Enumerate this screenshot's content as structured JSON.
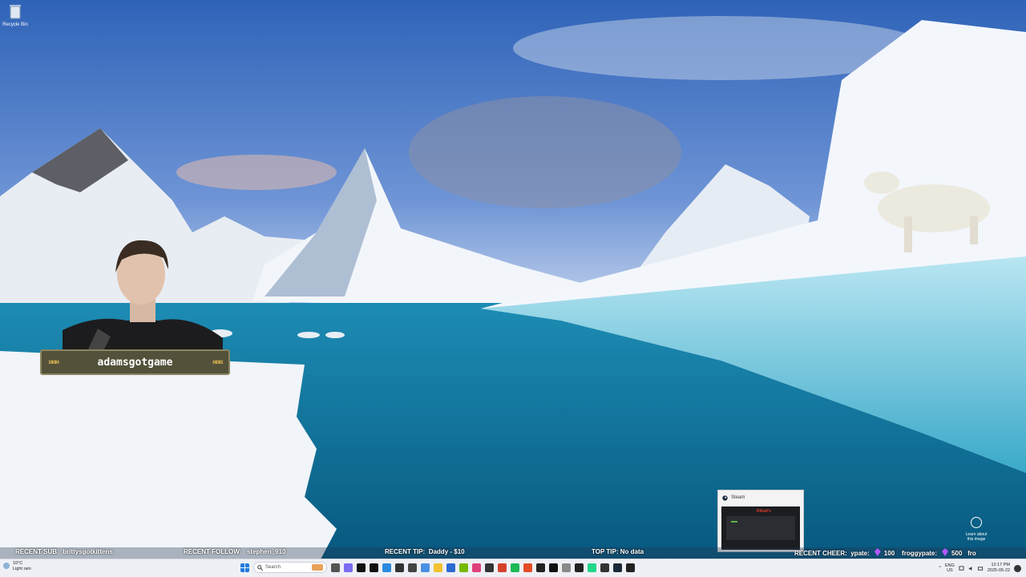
{
  "desktop": {
    "icons": [
      {
        "label": "Recycle Bin",
        "icon": "recycle-bin-icon"
      }
    ]
  },
  "overlay": {
    "streamer_name": "adamsgotgame",
    "ticker": {
      "recent_sub_label": "RECENT SUB:",
      "recent_sub_value": "brittysgotkittens",
      "recent_follow_label": "RECENT FOLLOW:",
      "recent_follow_value": "stephen_910",
      "recent_tip_label": "RECENT TIP:",
      "recent_tip_value": "Daddy - $10",
      "top_tip_label": "TOP TIP:",
      "top_tip_value": "No data",
      "recent_cheer_label": "RECENT CHEER:",
      "cheers": [
        {
          "user": "ypate:",
          "amount": "100"
        },
        {
          "user": "froggypate:",
          "amount": "500"
        }
      ],
      "trailing": "fro"
    }
  },
  "notification": {
    "app": "Steam",
    "preview_text": "Ritual's"
  },
  "learn_about": {
    "line1": "Learn about",
    "line2": "this image"
  },
  "taskbar": {
    "weather_temp": "10°C",
    "weather_desc": "Light rain",
    "search_placeholder": "Search",
    "pinned": [
      {
        "name": "task-view-icon",
        "color": "#555"
      },
      {
        "name": "copilot-icon",
        "color": "#7b6cf0"
      },
      {
        "name": "tiktok-icon",
        "color": "#111"
      },
      {
        "name": "tiktok-2-icon",
        "color": "#111"
      },
      {
        "name": "edge-icon",
        "color": "#2a8be0"
      },
      {
        "name": "obs-icon",
        "color": "#333"
      },
      {
        "name": "app-icon",
        "color": "#444"
      },
      {
        "name": "photos-icon",
        "color": "#4a90e2"
      },
      {
        "name": "file-explorer-icon",
        "color": "#f2c230"
      },
      {
        "name": "store-icon",
        "color": "#2a6bd1"
      },
      {
        "name": "nvidia-icon",
        "color": "#76b900"
      },
      {
        "name": "app2-icon",
        "color": "#e0407a"
      },
      {
        "name": "app3-icon",
        "color": "#333"
      },
      {
        "name": "app4-icon",
        "color": "#d4422d"
      },
      {
        "name": "spotify-icon",
        "color": "#1db954"
      },
      {
        "name": "chrome-icon",
        "color": "#e44d26"
      },
      {
        "name": "app5-icon",
        "color": "#222"
      },
      {
        "name": "app6-icon",
        "color": "#111"
      },
      {
        "name": "app7-icon",
        "color": "#8a8a8a"
      },
      {
        "name": "app8-icon",
        "color": "#222"
      },
      {
        "name": "pycharm-icon",
        "color": "#21d789"
      },
      {
        "name": "app9-icon",
        "color": "#333"
      },
      {
        "name": "steam-icon",
        "color": "#1b2838"
      },
      {
        "name": "terminal-icon",
        "color": "#222"
      }
    ],
    "language_top": "ENG",
    "language_bottom": "US",
    "time": "12:17 PM",
    "date": "2025-05-22"
  }
}
